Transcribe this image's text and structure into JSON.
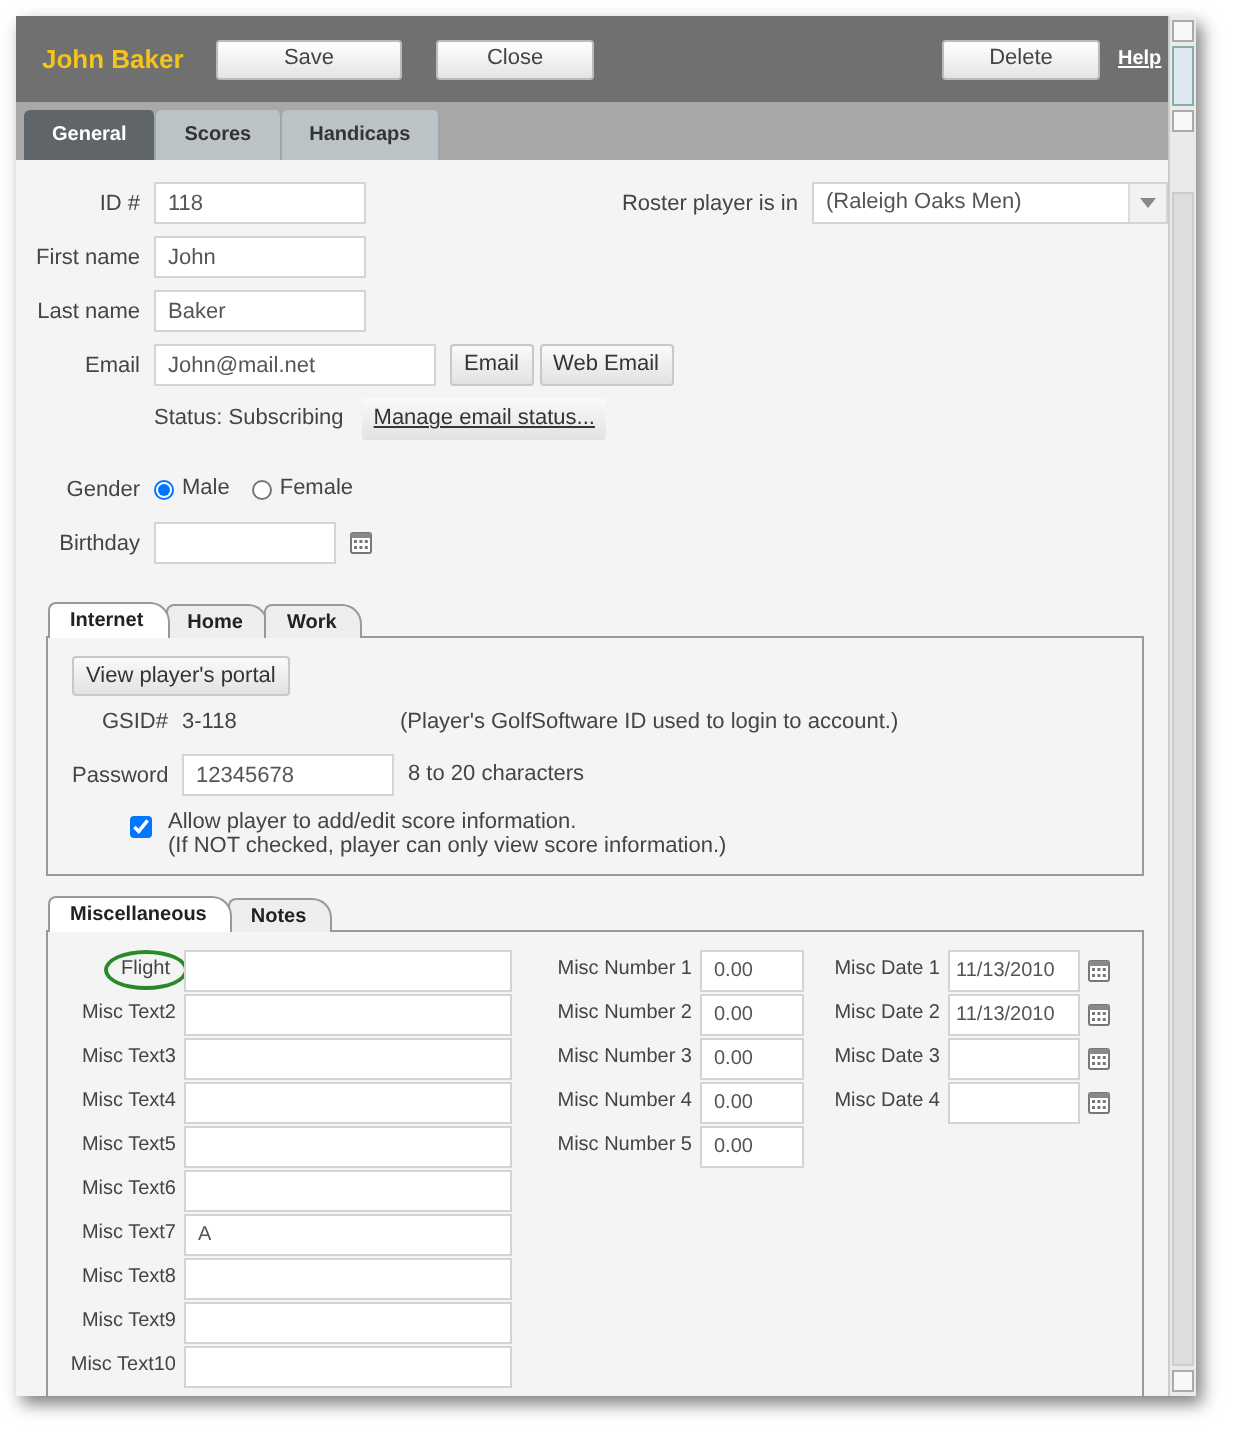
{
  "header": {
    "title": "John Baker",
    "buttons": [
      "Save",
      "Close",
      "Delete"
    ],
    "help": "Help"
  },
  "tabs": [
    {
      "label": "General",
      "selected": true
    },
    {
      "label": "Scores",
      "selected": false
    },
    {
      "label": "Handicaps",
      "selected": false
    }
  ],
  "identity": [
    {
      "label": "ID #",
      "value": "118"
    },
    {
      "label": "First name",
      "value": "John"
    },
    {
      "label": "Last name",
      "value": "Baker"
    }
  ],
  "roster": {
    "label": "Roster player is in",
    "value": "(Raleigh Oaks Men)"
  },
  "email": {
    "label": "Email",
    "value": "John@mail.net",
    "buttons": [
      "Email",
      "Web Email"
    ],
    "status": "Status: Subscribing",
    "manage": "Manage email status..."
  },
  "gender": {
    "label": "Gender",
    "options": [
      {
        "label": "Male",
        "selected": true
      },
      {
        "label": "Female",
        "selected": false
      }
    ]
  },
  "birthday": {
    "label": "Birthday"
  },
  "contact_tabs": [
    {
      "label": "Internet",
      "selected": true
    },
    {
      "label": "Home",
      "selected": false
    },
    {
      "label": "Work",
      "selected": false
    }
  ],
  "internet": {
    "portal_button": "View player's portal",
    "gsid_label": "GSID#",
    "gsid": "3-118",
    "gsid_note": "(Player's GolfSoftware ID used to login to account.)",
    "password_label": "Password",
    "password": "12345678",
    "password_hint": "8 to 20 characters",
    "allow_edit": {
      "checked": true,
      "lines": [
        "Allow player to add/edit score information.",
        "(If NOT checked, player can only view score information.)"
      ]
    }
  },
  "misc_tabs": [
    {
      "label": "Miscellaneous",
      "selected": true
    },
    {
      "label": "Notes",
      "selected": false
    }
  ],
  "misc_texts": [
    {
      "label": "Flight",
      "highlighted": true
    },
    {
      "label": "Misc Text2",
      "highlighted": false
    },
    {
      "label": "Misc Text3",
      "highlighted": false
    },
    {
      "label": "Misc Text4",
      "highlighted": false
    },
    {
      "label": "Misc Text5",
      "highlighted": false
    },
    {
      "label": "Misc Text6",
      "highlighted": false
    },
    {
      "label": "Misc Text7",
      "value": "A",
      "highlighted": false
    },
    {
      "label": "Misc Text8",
      "highlighted": false
    },
    {
      "label": "Misc Text9",
      "highlighted": false
    },
    {
      "label": "Misc Text10",
      "highlighted": false
    }
  ],
  "misc_numbers": [
    {
      "label": "Misc Number 1",
      "value": "0.00"
    },
    {
      "label": "Misc Number 2",
      "value": "0.00"
    },
    {
      "label": "Misc Number 3",
      "value": "0.00"
    },
    {
      "label": "Misc Number 4",
      "value": "0.00"
    },
    {
      "label": "Misc Number 5",
      "value": "0.00"
    }
  ],
  "misc_dates": [
    {
      "label": "Misc Date 1",
      "value": "11/13/2010"
    },
    {
      "label": "Misc Date 2",
      "value": "11/13/2010"
    },
    {
      "label": "Misc Date 3"
    },
    {
      "label": "Misc Date 4"
    }
  ]
}
